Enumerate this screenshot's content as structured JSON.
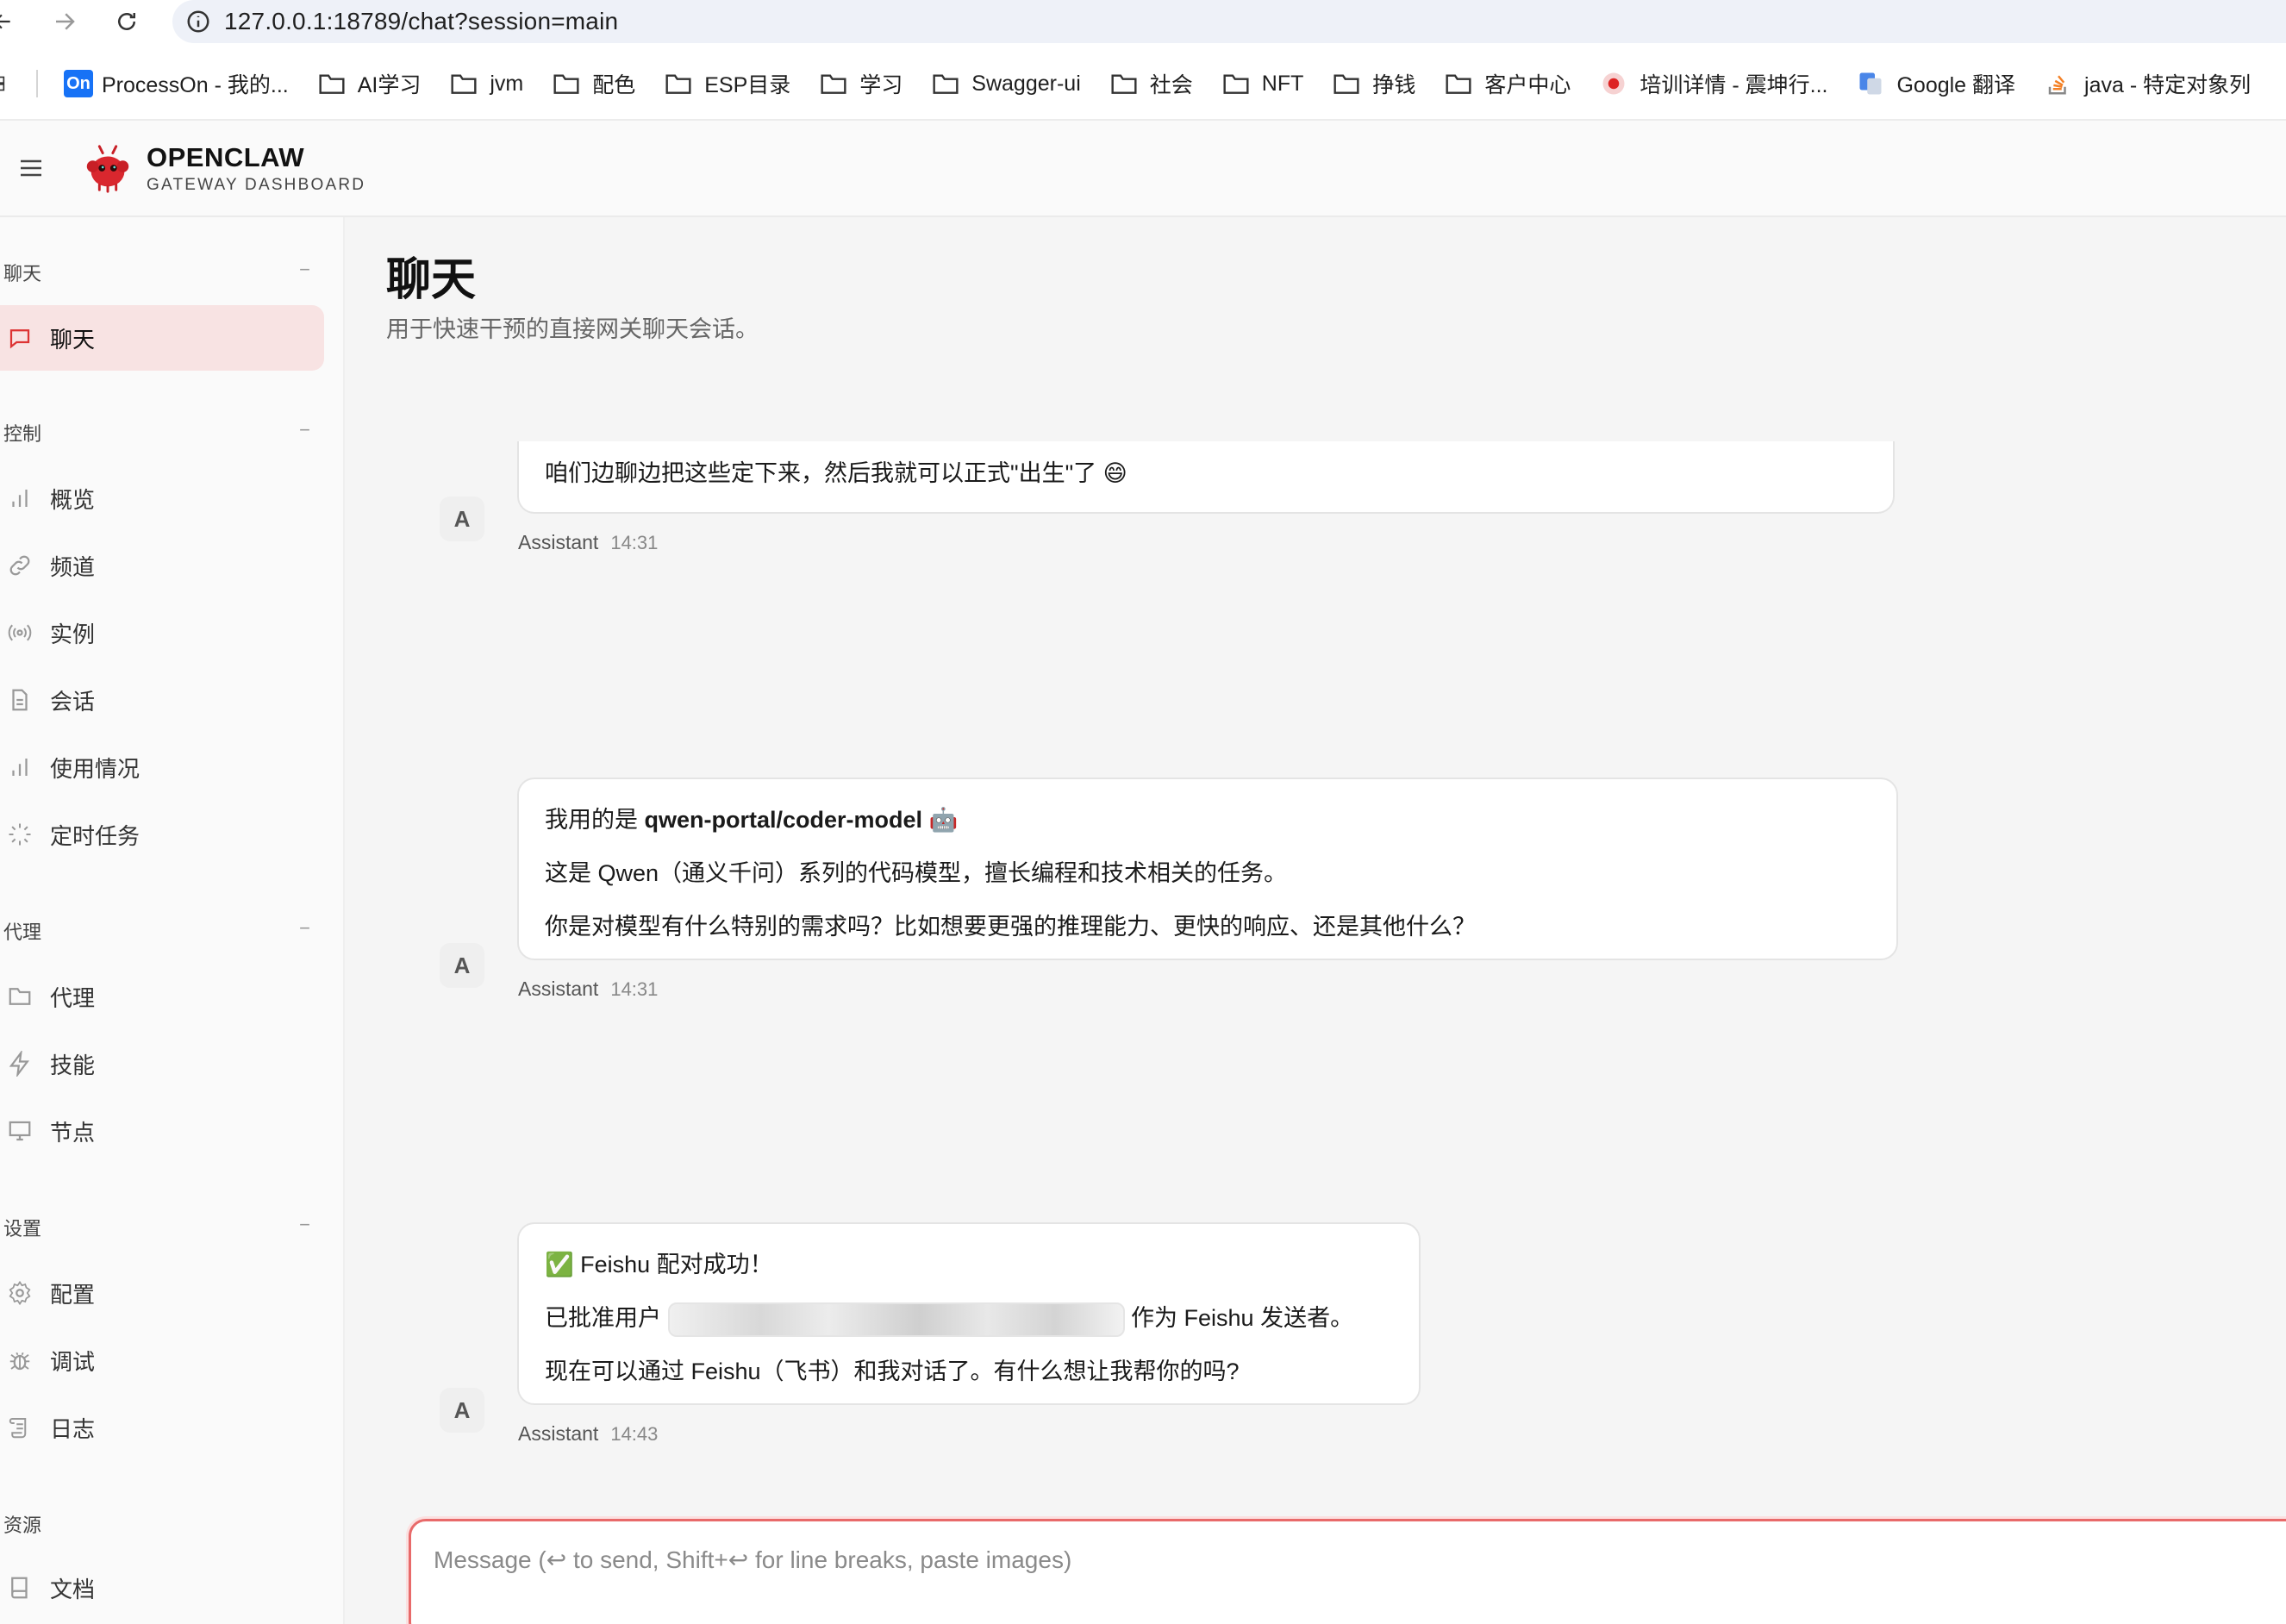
{
  "browser": {
    "url": "127.0.0.1:18789/chat?session=main",
    "bookmarks": [
      {
        "label": "ProcessOn - 我的...",
        "type": "on"
      },
      {
        "label": "AI学习",
        "type": "folder"
      },
      {
        "label": "jvm",
        "type": "folder"
      },
      {
        "label": "配色",
        "type": "folder"
      },
      {
        "label": "ESP目录",
        "type": "folder"
      },
      {
        "label": "学习",
        "type": "folder"
      },
      {
        "label": "Swagger-ui",
        "type": "folder"
      },
      {
        "label": "社会",
        "type": "folder"
      },
      {
        "label": "NFT",
        "type": "folder"
      },
      {
        "label": "挣钱",
        "type": "folder"
      },
      {
        "label": "客户中心",
        "type": "folder"
      },
      {
        "label": "培训详情 - 震坤行...",
        "type": "site"
      },
      {
        "label": "Google 翻译",
        "type": "translate"
      },
      {
        "label": "java - 特定对象列",
        "type": "stack"
      }
    ],
    "on_badge": "On"
  },
  "app": {
    "title": "OPENCLAW",
    "subtitle": "GATEWAY DASHBOARD"
  },
  "sidebar": {
    "groups": [
      {
        "label": "聊天",
        "collapse": "−"
      },
      {
        "label": "控制",
        "collapse": "−"
      },
      {
        "label": "代理",
        "collapse": "−"
      },
      {
        "label": "设置",
        "collapse": "−"
      },
      {
        "label": "资源",
        "collapse": ""
      }
    ],
    "items": {
      "chat": "聊天",
      "overview": "概览",
      "channels": "频道",
      "instances": "实例",
      "sessions": "会话",
      "usage": "使用情况",
      "cron": "定时任务",
      "agents": "代理",
      "skills": "技能",
      "nodes": "节点",
      "config": "配置",
      "debug": "调试",
      "logs": "日志",
      "docs": "文档"
    }
  },
  "main": {
    "title": "聊天",
    "subtitle": "用于快速干预的直接网关聊天会话。",
    "messages": [
      {
        "avatar": "A",
        "lines": [
          "咱们边聊边把这些定下来，然后我就可以正式\"出生\"了 😄"
        ],
        "sender": "Assistant",
        "time": "14:31"
      },
      {
        "avatar": "A",
        "line1_prefix": "我用的是 ",
        "line1_bold": "qwen-portal/coder-model",
        "line1_emoji": "🤖",
        "line2": "这是 Qwen（通义千问）系列的代码模型，擅长编程和技术相关的任务。",
        "line3": "你是对模型有什么特别的需求吗？比如想要更强的推理能力、更快的响应、还是其他什么？",
        "sender": "Assistant",
        "time": "14:31"
      },
      {
        "avatar": "A",
        "line1": "✅ Feishu 配对成功！",
        "line2_prefix": "已批准用户",
        "line2_suffix": "作为 Feishu 发送者。",
        "line3": "现在可以通过 Feishu（飞书）和我对话了。有什么想让我帮你的吗?",
        "sender": "Assistant",
        "time": "14:43"
      }
    ],
    "composer": {
      "placeholder": "Message (↩ to send, Shift+↩ for line breaks, paste images)",
      "value": ""
    }
  },
  "colors": {
    "accent": "#e05252",
    "active_bg": "#f8e3e3",
    "logo_red": "#d9272e"
  }
}
